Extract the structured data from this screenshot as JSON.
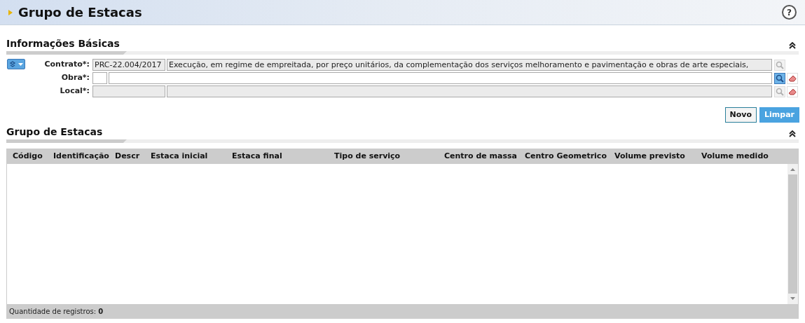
{
  "page": {
    "title": "Grupo de Estacas",
    "help": "?"
  },
  "basic": {
    "title": "Informações Básicas",
    "fields": [
      {
        "label": "Contrato*:",
        "inputs": [
          {
            "value": "PRC-22.004/2017",
            "disabled": true
          },
          {
            "value": "Execução, em regime de empreitada, por preço unitários, da complementação dos serviços melhoramento e pavimentação e obras de arte especiais,",
            "disabled": true
          }
        ],
        "search_disabled": true,
        "clear": false
      },
      {
        "label": "Obra*:",
        "inputs": [
          {
            "disabled": false
          },
          {
            "disabled": false
          }
        ],
        "search_disabled": false,
        "clear": true
      },
      {
        "label": "Local*:",
        "inputs": [
          {
            "disabled": true
          },
          {
            "disabled": true
          }
        ],
        "search_disabled": true,
        "clear": true
      }
    ],
    "buttons": [
      {
        "label": "Novo",
        "kind": "default"
      },
      {
        "label": "Limpar",
        "kind": "primary"
      }
    ]
  },
  "grid": {
    "title": "Grupo de Estacas",
    "columns": [
      "Código",
      "Identificação",
      "Descr",
      "Estaca inicial",
      "Estaca final",
      "Tipo de serviço",
      "Centro de massa",
      "Centro Geometrico",
      "Volume previsto",
      "Volume medido"
    ],
    "footer": "Quantidade de registros: **0**"
  }
}
